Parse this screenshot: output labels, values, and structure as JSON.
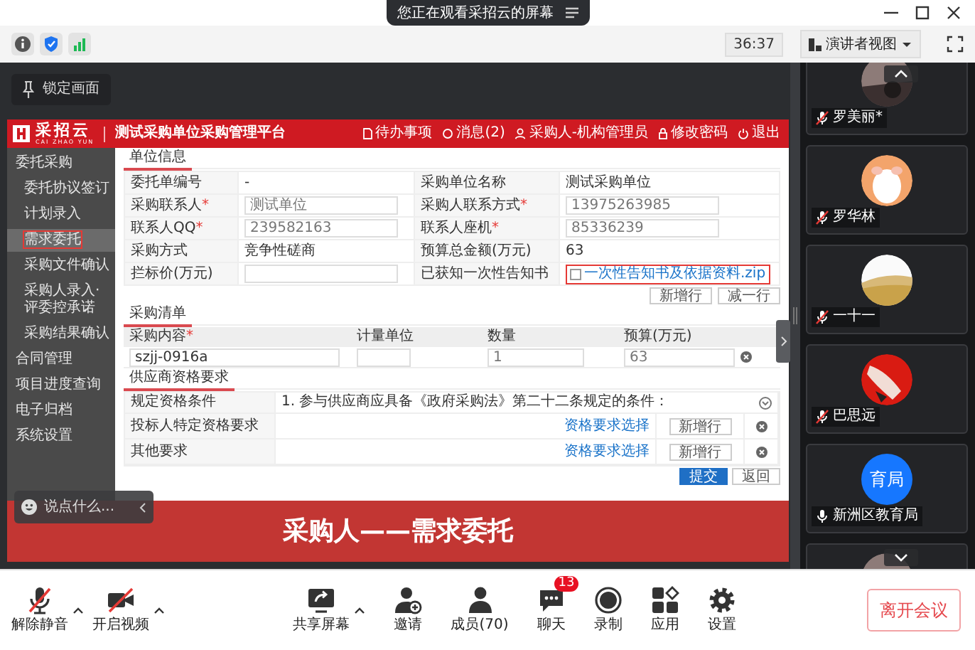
{
  "window": {
    "share_notice": "您正在观看采招云的屏幕"
  },
  "toolbar": {
    "timer": "36:37",
    "view_mode": "演讲者视图"
  },
  "stage": {
    "lock_button": "锁定画面",
    "chat_input": {
      "placeholder": "说点什么..."
    },
    "caption": "采购人——需求委托",
    "shared_screen": {
      "logo": "采招云",
      "logo_subtitle": "CAI ZHAO YUN",
      "platform_title": "测试采购单位采购管理平台",
      "header_links": [
        {
          "kind": "todo",
          "label": "待办事项"
        },
        {
          "kind": "message",
          "label": "消息(2)"
        },
        {
          "kind": "user",
          "label": "采购人-机构管理员"
        },
        {
          "kind": "lock",
          "label": "修改密码"
        },
        {
          "kind": "power",
          "label": "退出"
        }
      ],
      "sidebar": [
        {
          "label": "委托采购",
          "selected": false,
          "children": [
            {
              "label": "委托协议签订",
              "selected": false
            },
            {
              "label": "计划录入",
              "selected": false
            },
            {
              "label": "需求委托",
              "selected": true
            },
            {
              "label": "采购文件确认",
              "selected": false
            },
            {
              "label": "采购人录入·评委控承诺",
              "selected": false
            },
            {
              "label": "采购结果确认",
              "selected": false
            }
          ]
        },
        {
          "label": "合同管理",
          "selected": false
        },
        {
          "label": "项目进度查询",
          "selected": false
        },
        {
          "label": "电子归档",
          "selected": false
        },
        {
          "label": "系统设置",
          "selected": false
        }
      ],
      "unit_info": {
        "title": "单位信息",
        "fields": [
          {
            "kind": "text",
            "label": "委托单编号",
            "value": "-"
          },
          {
            "kind": "text",
            "label": "采购单位名称",
            "value": "测试采购单位"
          },
          {
            "kind": "input",
            "label": "采购联系人",
            "mark": "*",
            "value": "测试单位"
          },
          {
            "kind": "input",
            "label": "采购人联系方式",
            "mark": "*",
            "value": "13975263985"
          },
          {
            "kind": "input",
            "label": "联系人QQ",
            "mark": "*",
            "value": "239582163"
          },
          {
            "kind": "input",
            "label": "联系人座机",
            "mark": "*",
            "value": "85336239"
          },
          {
            "kind": "text",
            "label": "采购方式",
            "value": "竞争性磋商"
          },
          {
            "kind": "text",
            "label": "预算总金额(万元)",
            "value": "63"
          },
          {
            "kind": "input",
            "label": "拦标价(万元)"
          },
          {
            "kind": "attachment",
            "label": "已获知一次性告知书",
            "checked": false,
            "file": "一次性告知书及依据资料.zip"
          }
        ],
        "buttons": [
          "新增行",
          "减一行"
        ]
      },
      "purchase_list": {
        "title": "采购清单",
        "columns": [
          {
            "label": "采购内容",
            "mark": "*"
          },
          {
            "label": "计量单位"
          },
          {
            "label": "数量"
          },
          {
            "label": "预算(万元)"
          }
        ],
        "rows": [
          {
            "content": "szjj-0916a",
            "quantity": "1",
            "budget": "63"
          }
        ]
      },
      "qualifications": {
        "title": "供应商资格要求",
        "rows": [
          {
            "kind": "text",
            "label": "规定资格条件",
            "text": "1. 参与供应商应具备《政府采购法》第二十二条规定的条件："
          },
          {
            "kind": "editable",
            "label": "投标人特定资格要求",
            "link": "资格要求选择",
            "button": "新增行"
          },
          {
            "kind": "editable",
            "label": "其他要求",
            "link": "资格要求选择",
            "button": "新增行"
          }
        ]
      },
      "actions": [
        {
          "kind": "primary",
          "label": "提交"
        },
        {
          "kind": "default",
          "label": "返回"
        }
      ]
    }
  },
  "participants": [
    {
      "name": "罗美丽*",
      "muted": true,
      "avatar": {
        "kind": "picture"
      }
    },
    {
      "name": "罗华林",
      "muted": true,
      "avatar": {
        "kind": "picture"
      }
    },
    {
      "name": "一十一",
      "muted": true,
      "avatar": {
        "kind": "picture"
      }
    },
    {
      "name": "巴思远",
      "muted": true,
      "avatar": {
        "kind": "picture"
      }
    },
    {
      "name": "新洲区教育局",
      "muted": false,
      "avatar": {
        "kind": "text",
        "text": "育局"
      }
    },
    {
      "avatar": {
        "kind": "picture"
      }
    }
  ],
  "left_controls": [
    {
      "kind": "mic",
      "label": "解除静音",
      "menu": true
    },
    {
      "kind": "camera",
      "label": "开启视频",
      "menu": true
    }
  ],
  "center_controls": [
    {
      "kind": "share",
      "label": "共享屏幕",
      "menu": true
    },
    {
      "kind": "invite",
      "label": "邀请",
      "menu": false
    },
    {
      "kind": "members",
      "label": "成员(70)",
      "menu": false
    },
    {
      "kind": "chat",
      "label": "聊天",
      "menu": false,
      "badge": "13"
    },
    {
      "kind": "record",
      "label": "录制",
      "menu": false
    },
    {
      "kind": "apps",
      "label": "应用",
      "menu": false
    },
    {
      "kind": "settings",
      "label": "设置",
      "menu": false
    }
  ],
  "leave_button": "离开会议"
}
